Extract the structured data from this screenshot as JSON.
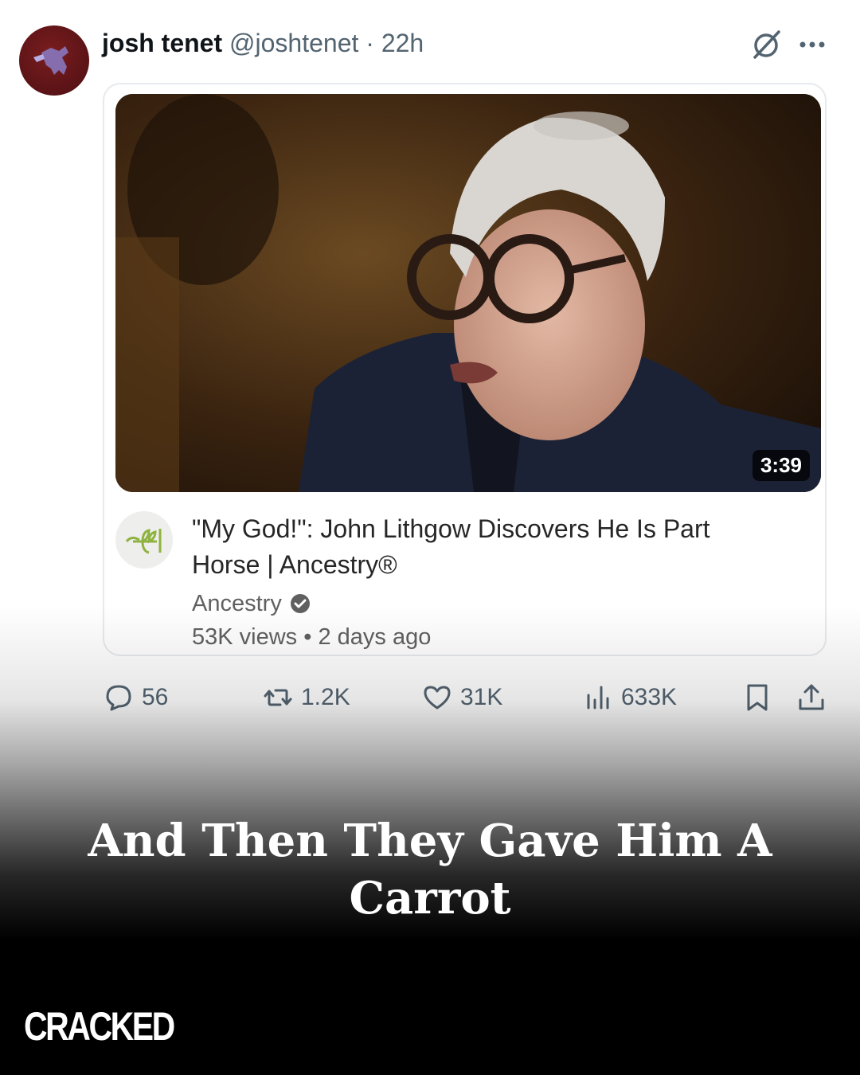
{
  "post": {
    "author_name": "josh tenet",
    "author_handle": "@joshtenet",
    "separator": "·",
    "time": "22h",
    "icons": {
      "grok": "grok-icon",
      "more": "more-dots-icon"
    }
  },
  "video_card": {
    "duration": "3:39",
    "title": "\"My God!\": John Lithgow Discovers He Is Part Horse | Ancestry®",
    "channel": "Ancestry",
    "views": "53K views",
    "meta_separator": "•",
    "age": "2 days ago"
  },
  "actions": {
    "replies": "56",
    "reposts": "1.2K",
    "likes": "31K",
    "views": "633K"
  },
  "overlay": {
    "caption": "And Then They Gave Him A Carrot",
    "brand": "CRACKED"
  },
  "colors": {
    "secondary_text": "#536471",
    "avatar_bg": "#5a1316",
    "caption_text": "#ffffff"
  }
}
